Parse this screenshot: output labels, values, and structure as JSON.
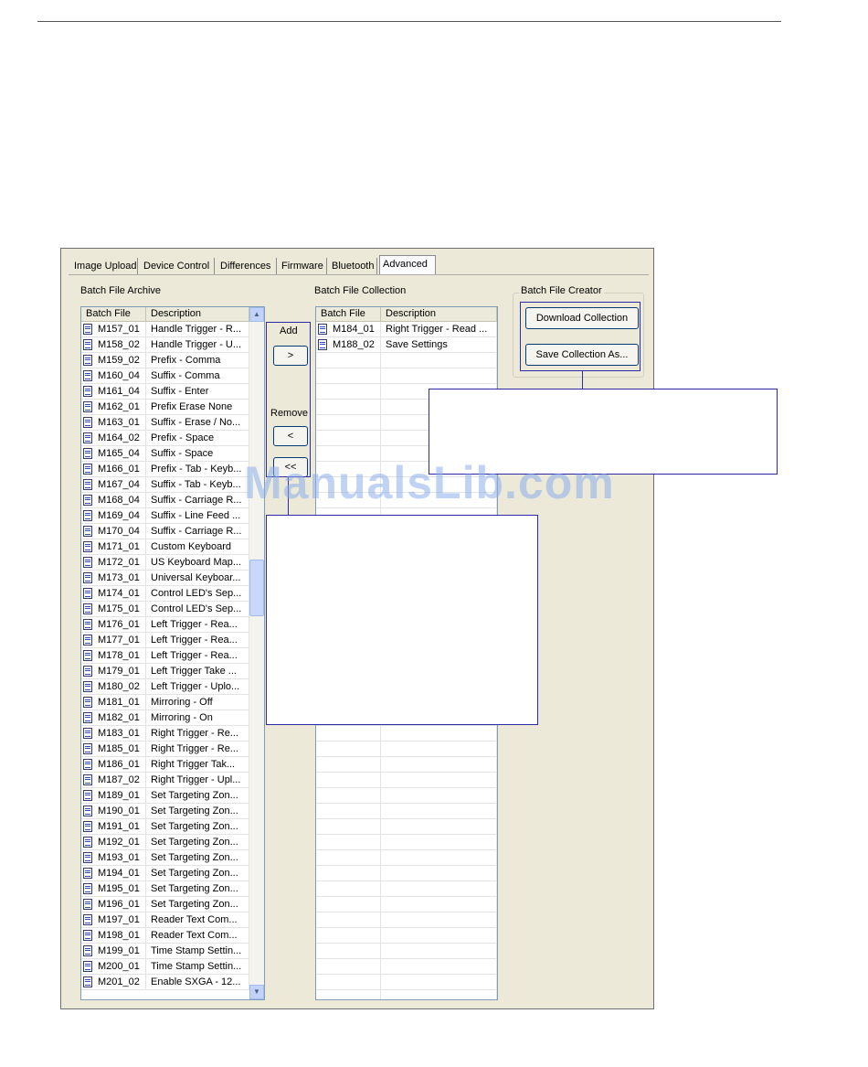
{
  "tabs": [
    {
      "label": "Image Upload"
    },
    {
      "label": "Device Control"
    },
    {
      "label": "Differences"
    },
    {
      "label": "Firmware"
    },
    {
      "label": "Bluetooth"
    },
    {
      "label": "Advanced",
      "active": true
    }
  ],
  "archive": {
    "title": "Batch File Archive",
    "columns": [
      "Batch File",
      "Description"
    ],
    "rows": [
      {
        "file": "M157_01",
        "desc": "Handle Trigger - R..."
      },
      {
        "file": "M158_02",
        "desc": "Handle Trigger - U..."
      },
      {
        "file": "M159_02",
        "desc": "Prefix - Comma"
      },
      {
        "file": "M160_04",
        "desc": "Suffix - Comma"
      },
      {
        "file": "M161_04",
        "desc": "Suffix - Enter"
      },
      {
        "file": "M162_01",
        "desc": "Prefix Erase None"
      },
      {
        "file": "M163_01",
        "desc": "Suffix - Erase / No..."
      },
      {
        "file": "M164_02",
        "desc": "Prefix - Space"
      },
      {
        "file": "M165_04",
        "desc": "Suffix - Space"
      },
      {
        "file": "M166_01",
        "desc": "Prefix - Tab - Keyb..."
      },
      {
        "file": "M167_04",
        "desc": "Suffix - Tab - Keyb..."
      },
      {
        "file": "M168_04",
        "desc": "Suffix - Carriage R..."
      },
      {
        "file": "M169_04",
        "desc": "Suffix - Line Feed ..."
      },
      {
        "file": "M170_04",
        "desc": "Suffix - Carriage R..."
      },
      {
        "file": "M171_01",
        "desc": "Custom Keyboard"
      },
      {
        "file": "M172_01",
        "desc": "US Keyboard Map..."
      },
      {
        "file": "M173_01",
        "desc": "Universal Keyboar..."
      },
      {
        "file": "M174_01",
        "desc": "Control LED's Sep..."
      },
      {
        "file": "M175_01",
        "desc": "Control LED's Sep..."
      },
      {
        "file": "M176_01",
        "desc": "Left Trigger - Rea..."
      },
      {
        "file": "M177_01",
        "desc": "Left Trigger - Rea..."
      },
      {
        "file": "M178_01",
        "desc": "Left Trigger - Rea..."
      },
      {
        "file": "M179_01",
        "desc": "Left Trigger Take ..."
      },
      {
        "file": "M180_02",
        "desc": "Left Trigger - Uplo..."
      },
      {
        "file": "M181_01",
        "desc": "Mirroring - Off"
      },
      {
        "file": "M182_01",
        "desc": "Mirroring - On"
      },
      {
        "file": "M183_01",
        "desc": "Right Trigger - Re..."
      },
      {
        "file": "M185_01",
        "desc": "Right Trigger - Re..."
      },
      {
        "file": "M186_01",
        "desc": "Right Trigger Tak..."
      },
      {
        "file": "M187_02",
        "desc": "Right Trigger - Upl..."
      },
      {
        "file": "M189_01",
        "desc": "Set Targeting Zon..."
      },
      {
        "file": "M190_01",
        "desc": "Set Targeting Zon..."
      },
      {
        "file": "M191_01",
        "desc": "Set Targeting Zon..."
      },
      {
        "file": "M192_01",
        "desc": "Set Targeting Zon..."
      },
      {
        "file": "M193_01",
        "desc": "Set Targeting Zon..."
      },
      {
        "file": "M194_01",
        "desc": "Set Targeting Zon..."
      },
      {
        "file": "M195_01",
        "desc": "Set Targeting Zon..."
      },
      {
        "file": "M196_01",
        "desc": "Set Targeting Zon..."
      },
      {
        "file": "M197_01",
        "desc": "Reader Text Com..."
      },
      {
        "file": "M198_01",
        "desc": "Reader Text Com..."
      },
      {
        "file": "M199_01",
        "desc": "Time Stamp Settin..."
      },
      {
        "file": "M200_01",
        "desc": "Time Stamp Settin..."
      },
      {
        "file": "M201_02",
        "desc": "Enable SXGA - 12..."
      }
    ]
  },
  "controls": {
    "add_label": "Add",
    "add_button": ">",
    "remove_label": "Remove",
    "remove_button": "<",
    "remove_all_button": "<<"
  },
  "collection": {
    "title": "Batch File Collection",
    "columns": [
      "Batch File",
      "Description"
    ],
    "rows": [
      {
        "file": "M184_01",
        "desc": "Right Trigger - Read ..."
      },
      {
        "file": "M188_02",
        "desc": "Save Settings"
      }
    ],
    "empty_rows": 42
  },
  "creator": {
    "title": "Batch File Creator",
    "download_button": "Download Collection",
    "save_button": "Save Collection As..."
  },
  "watermark": "ManualsLib.com"
}
